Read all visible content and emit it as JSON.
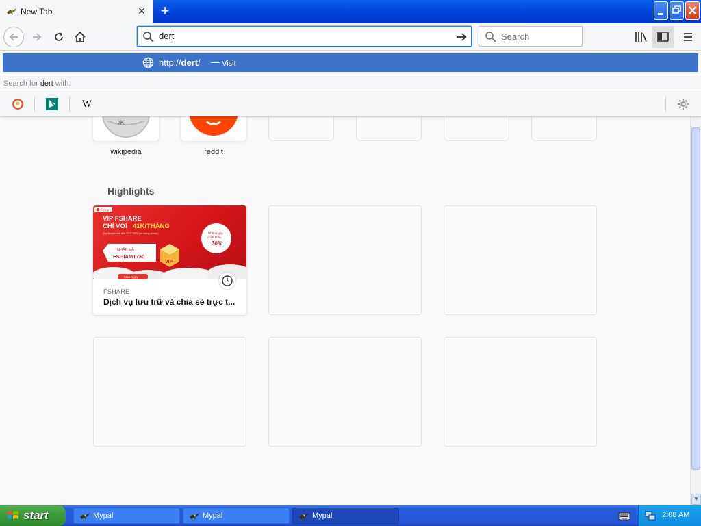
{
  "tab": {
    "title": "New Tab"
  },
  "url_bar": {
    "value": "dert"
  },
  "search_bar": {
    "placeholder": "Search"
  },
  "dropdown": {
    "result_prefix": "http://",
    "result_domain": "dert",
    "result_suffix": "/",
    "result_separator": "—",
    "result_action": "Visit",
    "search_with_prefix": "Search for",
    "search_with_query": "dert",
    "search_with_suffix": "with:",
    "engines": [
      "duckduckgo-icon",
      "bing-icon",
      "wikipedia-icon"
    ],
    "wiki_glyph": "W"
  },
  "top_sites": [
    {
      "label": "wikipedia"
    },
    {
      "label": "reddit"
    }
  ],
  "highlights": {
    "title": "Highlights",
    "card": {
      "source": "FSHARE",
      "title": "Dịch vụ lưu trữ và chia sẻ trực t...",
      "image": {
        "brand": "Fshare",
        "headline_1": "VIP FSHARE",
        "headline_2": "CHỈ VỚI",
        "headline_price": "41K/THÁNG",
        "fineprint": "Quy khuyến mãi đến 15.07.2022 (số lượng có hạn)",
        "code_label": "NHẬP MÃ",
        "code": "FSGIAMT730",
        "badge_1": "Nhận ngay",
        "badge_2": "chiết khấu",
        "badge_3": "30%",
        "vip": "VIP",
        "cta": "Mua Ngay"
      }
    }
  },
  "taskbar": {
    "start_label": "start",
    "tasks": [
      {
        "label": "Mypal"
      },
      {
        "label": "Mypal"
      },
      {
        "label": "Mypal"
      }
    ],
    "clock": "2:08 AM"
  },
  "colors": {
    "accent": "#0a84ff",
    "dropdown_highlight": "#3b72cc",
    "reddit": "#ff4500",
    "fshare_red": "#e8332a"
  }
}
